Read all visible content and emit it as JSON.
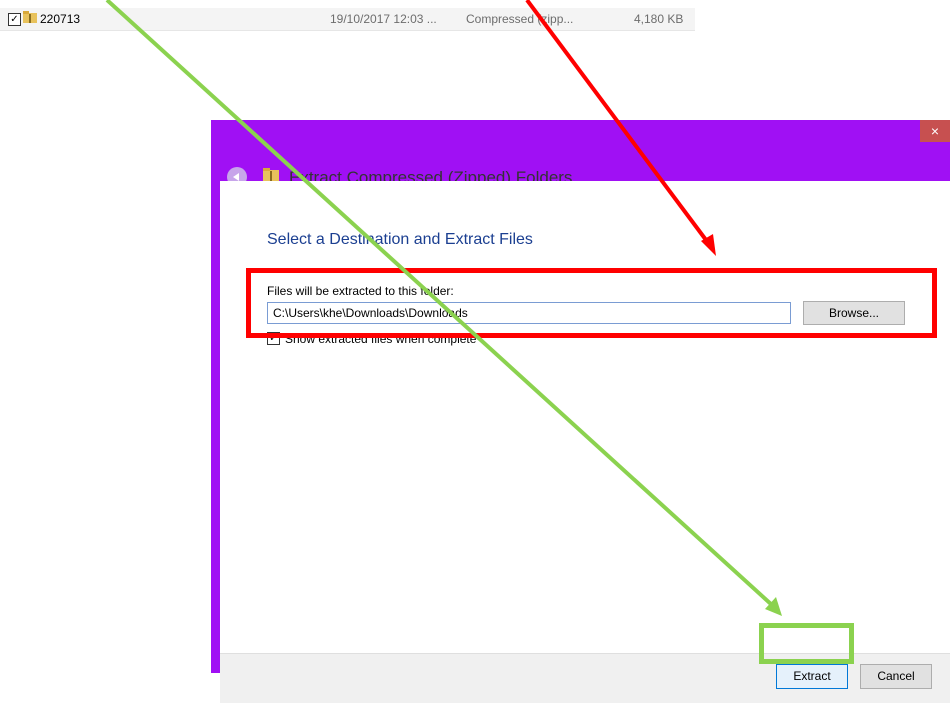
{
  "file_row": {
    "name": "220713",
    "date": "19/10/2017 12:03 ...",
    "type": "Compressed (zipp...",
    "size": "4,180 KB",
    "check_mark": "✓",
    "icon": "zip-folder-icon"
  },
  "dialog": {
    "title": "Extract Compressed (Zipped) Folders",
    "close_label": "×",
    "heading": "Select a Destination and Extract Files",
    "folder_label": "Files will be extracted to this folder:",
    "path_value": "C:\\Users\\khe\\Downloads\\Downloads",
    "browse_label": "Browse...",
    "show_files_label": "Show extracted files when complete",
    "show_files_check": "✓",
    "extract_label": "Extract",
    "cancel_label": "Cancel"
  },
  "colors": {
    "dialog_frame": "#a010f4",
    "annotation_red": "#ff0000",
    "annotation_green": "#8bd24f",
    "heading_blue": "#1b3f91"
  }
}
